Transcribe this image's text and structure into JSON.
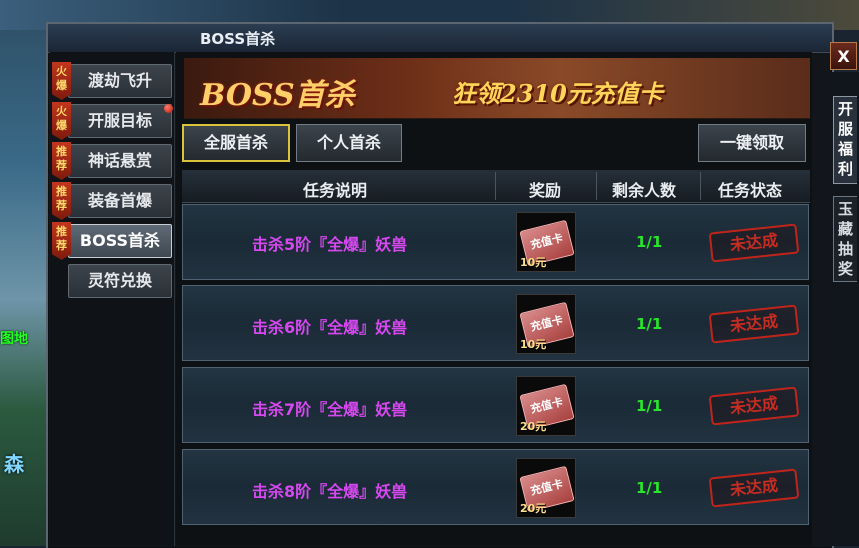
{
  "window": {
    "title": "BOSS首杀",
    "close_label": "X"
  },
  "right_tabs": [
    {
      "label": "开服福利",
      "active": true
    },
    {
      "label": "玉藏抽奖",
      "active": false
    }
  ],
  "map_labels": [
    "图地",
    "森"
  ],
  "sidebar": {
    "items": [
      {
        "label": "渡劫飞升",
        "tag": "火爆",
        "active": false,
        "dot": false
      },
      {
        "label": "开服目标",
        "tag": "火爆",
        "active": false,
        "dot": true
      },
      {
        "label": "神话悬赏",
        "tag": "推荐",
        "active": false,
        "dot": false
      },
      {
        "label": "装备首爆",
        "tag": "推荐",
        "active": false,
        "dot": false
      },
      {
        "label": "BOSS首杀",
        "tag": "推荐",
        "active": true,
        "dot": false
      },
      {
        "label": "灵符兑换",
        "tag": "",
        "active": false,
        "dot": false
      }
    ]
  },
  "banner": {
    "title": "BOSS首杀",
    "subtitle": "狂领2310元充值卡"
  },
  "tabs": [
    {
      "label": "全服首杀",
      "active": true
    },
    {
      "label": "个人首杀",
      "active": false
    }
  ],
  "claim_all_label": "一键领取",
  "table": {
    "headers": [
      "任务说明",
      "奖励",
      "剩余人数",
      "任务状态"
    ],
    "rows": [
      {
        "task": "击杀5阶『全爆』妖兽",
        "reward_card": "充值卡",
        "reward_value": "10元",
        "remaining": "1/1",
        "status": "未达成"
      },
      {
        "task": "击杀6阶『全爆』妖兽",
        "reward_card": "充值卡",
        "reward_value": "10元",
        "remaining": "1/1",
        "status": "未达成"
      },
      {
        "task": "击杀7阶『全爆』妖兽",
        "reward_card": "充值卡",
        "reward_value": "20元",
        "remaining": "1/1",
        "status": "未达成"
      },
      {
        "task": "击杀8阶『全爆』妖兽",
        "reward_card": "充值卡",
        "reward_value": "20元",
        "remaining": "1/1",
        "status": "未达成"
      }
    ]
  },
  "colors": {
    "task_text": "#d648f0",
    "count_text": "#29e52b",
    "status_red": "#c62d22",
    "tab_active_border": "#d8c33a"
  }
}
